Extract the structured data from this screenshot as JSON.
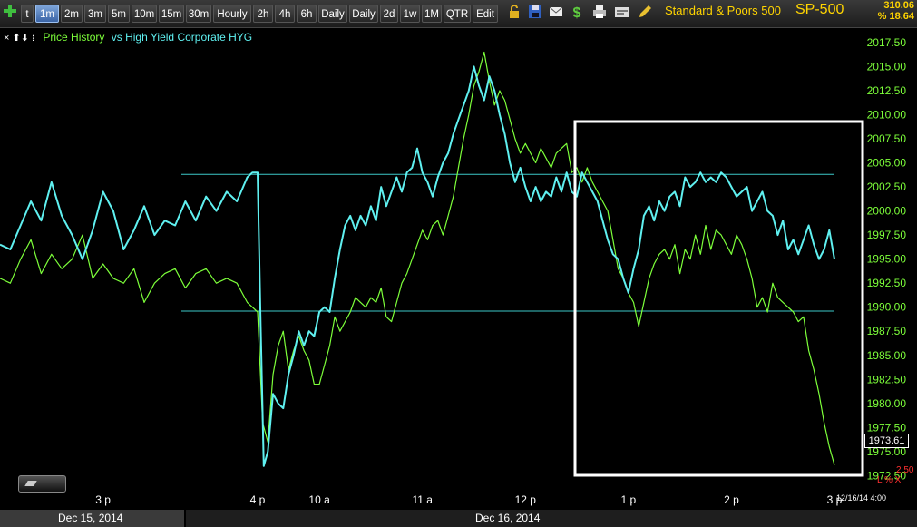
{
  "toolbar": {
    "timeframes": [
      "t",
      "1m",
      "2m",
      "3m",
      "5m",
      "10m",
      "15m",
      "30m",
      "Hourly",
      "2h",
      "4h",
      "6h",
      "Daily",
      "Daily",
      "2d",
      "1w",
      "1M",
      "QTR",
      "Edit"
    ],
    "active_timeframe": "1m",
    "icons": [
      "lock-icon",
      "save-icon",
      "email-icon",
      "dollar-icon",
      "print-icon",
      "settings-icon",
      "pencil-icon"
    ]
  },
  "symbol": {
    "name": "Standard & Poors 500",
    "ticker": "SP-500",
    "quote_top": "310.06",
    "quote_bottom": "% 18.64"
  },
  "legend": {
    "controls": "× ⬆⬇ ⁞",
    "price_label": "Price History",
    "vs_label": "vs High Yield Corporate HYG"
  },
  "price_tag": "1973.61",
  "side_labels": {
    "value": "2.50",
    "flags": "L % X"
  },
  "footer": {
    "timestamp": "12/16/14 4:00",
    "date1": "Dec 15, 2014",
    "date2": "Dec 16, 2014"
  },
  "colors": {
    "price": "#7dff3a",
    "hyg": "#5ff0f0",
    "axis_text": "#7dff3a",
    "background": "#000000",
    "highlight_box": "#ffffff",
    "hline": "#3cc8c8"
  },
  "chart_data": {
    "type": "line",
    "title": "",
    "y_ticks": [
      2017.5,
      2015.0,
      2012.5,
      2010.0,
      2007.5,
      2005.0,
      2002.5,
      2000.0,
      1997.5,
      1995.0,
      1992.5,
      1990.0,
      1987.5,
      1985.0,
      1982.5,
      1980.0,
      1977.5,
      1975.0,
      1972.5
    ],
    "ylim": [
      1971.5,
      2019.0
    ],
    "x_labels": [
      "3 p",
      "4 p",
      "10 a",
      "11 a",
      "12 p",
      "1 p",
      "2 p",
      "3 p"
    ],
    "x_label_pos": [
      1.5,
      3.0,
      3.6,
      4.6,
      5.6,
      6.6,
      7.6,
      8.6
    ],
    "xlim": [
      0.5,
      8.6
    ],
    "horizontal_lines": [
      2003.8,
      1989.6
    ],
    "series": [
      {
        "name": "Price History",
        "color": "#7dff3a",
        "points": [
          [
            0.5,
            1993.0
          ],
          [
            0.6,
            1992.5
          ],
          [
            0.7,
            1995.0
          ],
          [
            0.8,
            1997.0
          ],
          [
            0.9,
            1993.5
          ],
          [
            1.0,
            1995.5
          ],
          [
            1.1,
            1994.0
          ],
          [
            1.2,
            1995.0
          ],
          [
            1.3,
            1997.5
          ],
          [
            1.4,
            1993.0
          ],
          [
            1.5,
            1994.5
          ],
          [
            1.6,
            1993.0
          ],
          [
            1.7,
            1992.5
          ],
          [
            1.8,
            1994.0
          ],
          [
            1.9,
            1990.5
          ],
          [
            2.0,
            1992.5
          ],
          [
            2.1,
            1993.5
          ],
          [
            2.2,
            1994.0
          ],
          [
            2.3,
            1992.0
          ],
          [
            2.4,
            1993.5
          ],
          [
            2.5,
            1994.0
          ],
          [
            2.6,
            1992.5
          ],
          [
            2.7,
            1993.0
          ],
          [
            2.8,
            1992.5
          ],
          [
            2.9,
            1990.5
          ],
          [
            2.95,
            1990.0
          ],
          [
            3.0,
            1989.5
          ],
          [
            3.05,
            1978.0
          ],
          [
            3.1,
            1976.0
          ],
          [
            3.15,
            1983.0
          ],
          [
            3.2,
            1986.0
          ],
          [
            3.25,
            1987.5
          ],
          [
            3.3,
            1983.5
          ],
          [
            3.35,
            1985.5
          ],
          [
            3.4,
            1987.0
          ],
          [
            3.45,
            1985.5
          ],
          [
            3.5,
            1984.5
          ],
          [
            3.55,
            1982.0
          ],
          [
            3.6,
            1982.0
          ],
          [
            3.65,
            1984.0
          ],
          [
            3.7,
            1986.0
          ],
          [
            3.75,
            1989.0
          ],
          [
            3.8,
            1987.5
          ],
          [
            3.85,
            1988.5
          ],
          [
            3.9,
            1989.5
          ],
          [
            3.95,
            1991.0
          ],
          [
            4.0,
            1990.5
          ],
          [
            4.05,
            1990.0
          ],
          [
            4.1,
            1991.0
          ],
          [
            4.15,
            1990.5
          ],
          [
            4.2,
            1992.0
          ],
          [
            4.25,
            1989.0
          ],
          [
            4.3,
            1988.5
          ],
          [
            4.35,
            1990.5
          ],
          [
            4.4,
            1992.5
          ],
          [
            4.45,
            1993.5
          ],
          [
            4.5,
            1995.0
          ],
          [
            4.55,
            1996.5
          ],
          [
            4.6,
            1998.0
          ],
          [
            4.65,
            1997.0
          ],
          [
            4.7,
            1998.5
          ],
          [
            4.75,
            1999.0
          ],
          [
            4.8,
            1997.5
          ],
          [
            4.85,
            1999.5
          ],
          [
            4.9,
            2001.5
          ],
          [
            4.95,
            2004.5
          ],
          [
            5.0,
            2007.5
          ],
          [
            5.05,
            2010.0
          ],
          [
            5.1,
            2013.0
          ],
          [
            5.15,
            2014.5
          ],
          [
            5.2,
            2016.5
          ],
          [
            5.25,
            2013.5
          ],
          [
            5.3,
            2011.0
          ],
          [
            5.35,
            2012.5
          ],
          [
            5.4,
            2011.5
          ],
          [
            5.45,
            2009.5
          ],
          [
            5.5,
            2007.5
          ],
          [
            5.55,
            2006.0
          ],
          [
            5.6,
            2007.0
          ],
          [
            5.65,
            2006.0
          ],
          [
            5.7,
            2005.0
          ],
          [
            5.75,
            2006.5
          ],
          [
            5.8,
            2005.5
          ],
          [
            5.85,
            2004.5
          ],
          [
            5.9,
            2006.0
          ],
          [
            5.95,
            2006.5
          ],
          [
            6.0,
            2007.0
          ],
          [
            6.05,
            2004.0
          ],
          [
            6.1,
            2004.5
          ],
          [
            6.15,
            2003.0
          ],
          [
            6.2,
            2004.5
          ],
          [
            6.25,
            2003.0
          ],
          [
            6.3,
            2002.0
          ],
          [
            6.35,
            2001.0
          ],
          [
            6.4,
            2000.0
          ],
          [
            6.45,
            1997.0
          ],
          [
            6.5,
            1994.0
          ],
          [
            6.55,
            1993.0
          ],
          [
            6.6,
            1991.5
          ],
          [
            6.65,
            1990.5
          ],
          [
            6.7,
            1988.0
          ],
          [
            6.75,
            1990.5
          ],
          [
            6.8,
            1993.0
          ],
          [
            6.85,
            1994.5
          ],
          [
            6.9,
            1995.5
          ],
          [
            6.95,
            1996.0
          ],
          [
            7.0,
            1995.0
          ],
          [
            7.05,
            1996.5
          ],
          [
            7.1,
            1993.5
          ],
          [
            7.15,
            1996.0
          ],
          [
            7.2,
            1995.0
          ],
          [
            7.25,
            1997.5
          ],
          [
            7.3,
            1995.5
          ],
          [
            7.35,
            1998.5
          ],
          [
            7.4,
            1996.0
          ],
          [
            7.45,
            1998.0
          ],
          [
            7.5,
            1997.5
          ],
          [
            7.55,
            1996.5
          ],
          [
            7.6,
            1995.5
          ],
          [
            7.65,
            1997.5
          ],
          [
            7.7,
            1996.5
          ],
          [
            7.75,
            1995.0
          ],
          [
            7.8,
            1993.0
          ],
          [
            7.85,
            1990.0
          ],
          [
            7.9,
            1991.0
          ],
          [
            7.95,
            1989.5
          ],
          [
            8.0,
            1992.5
          ],
          [
            8.05,
            1991.0
          ],
          [
            8.1,
            1990.5
          ],
          [
            8.15,
            1990.0
          ],
          [
            8.2,
            1989.5
          ],
          [
            8.25,
            1988.5
          ],
          [
            8.3,
            1989.0
          ],
          [
            8.35,
            1985.5
          ],
          [
            8.4,
            1983.5
          ],
          [
            8.45,
            1981.0
          ],
          [
            8.5,
            1978.0
          ],
          [
            8.55,
            1975.5
          ],
          [
            8.6,
            1973.6
          ]
        ]
      },
      {
        "name": "vs High Yield Corporate HYG",
        "color": "#5ff0f0",
        "points": [
          [
            0.5,
            1996.5
          ],
          [
            0.6,
            1996.0
          ],
          [
            0.7,
            1998.5
          ],
          [
            0.8,
            2001.0
          ],
          [
            0.9,
            1999.0
          ],
          [
            1.0,
            2003.0
          ],
          [
            1.1,
            1999.5
          ],
          [
            1.2,
            1997.5
          ],
          [
            1.3,
            1995.0
          ],
          [
            1.4,
            1998.0
          ],
          [
            1.5,
            2002.0
          ],
          [
            1.6,
            2000.0
          ],
          [
            1.7,
            1996.0
          ],
          [
            1.8,
            1998.0
          ],
          [
            1.9,
            2000.5
          ],
          [
            2.0,
            1997.5
          ],
          [
            2.1,
            1999.0
          ],
          [
            2.2,
            1998.5
          ],
          [
            2.3,
            2001.0
          ],
          [
            2.4,
            1999.0
          ],
          [
            2.5,
            2001.5
          ],
          [
            2.6,
            2000.0
          ],
          [
            2.7,
            2002.0
          ],
          [
            2.8,
            2001.0
          ],
          [
            2.9,
            2003.5
          ],
          [
            2.95,
            2004.0
          ],
          [
            3.0,
            2004.0
          ],
          [
            3.03,
            1988.0
          ],
          [
            3.06,
            1973.5
          ],
          [
            3.1,
            1975.0
          ],
          [
            3.15,
            1981.0
          ],
          [
            3.2,
            1980.0
          ],
          [
            3.25,
            1979.5
          ],
          [
            3.3,
            1983.0
          ],
          [
            3.35,
            1985.0
          ],
          [
            3.4,
            1987.5
          ],
          [
            3.45,
            1986.0
          ],
          [
            3.5,
            1987.5
          ],
          [
            3.55,
            1987.0
          ],
          [
            3.6,
            1989.5
          ],
          [
            3.65,
            1990.0
          ],
          [
            3.7,
            1989.5
          ],
          [
            3.75,
            1993.0
          ],
          [
            3.8,
            1996.0
          ],
          [
            3.85,
            1998.5
          ],
          [
            3.9,
            1999.5
          ],
          [
            3.95,
            1998.0
          ],
          [
            4.0,
            1999.5
          ],
          [
            4.05,
            1998.5
          ],
          [
            4.1,
            2000.5
          ],
          [
            4.15,
            1999.0
          ],
          [
            4.2,
            2002.5
          ],
          [
            4.25,
            2000.5
          ],
          [
            4.3,
            2002.0
          ],
          [
            4.35,
            2003.5
          ],
          [
            4.4,
            2002.0
          ],
          [
            4.45,
            2004.0
          ],
          [
            4.5,
            2004.5
          ],
          [
            4.55,
            2006.5
          ],
          [
            4.6,
            2004.0
          ],
          [
            4.65,
            2003.0
          ],
          [
            4.7,
            2001.5
          ],
          [
            4.75,
            2003.5
          ],
          [
            4.8,
            2005.0
          ],
          [
            4.85,
            2006.0
          ],
          [
            4.9,
            2008.0
          ],
          [
            4.95,
            2009.5
          ],
          [
            5.0,
            2011.0
          ],
          [
            5.05,
            2012.5
          ],
          [
            5.1,
            2015.0
          ],
          [
            5.15,
            2013.0
          ],
          [
            5.2,
            2011.5
          ],
          [
            5.25,
            2014.0
          ],
          [
            5.3,
            2012.5
          ],
          [
            5.35,
            2010.0
          ],
          [
            5.4,
            2008.0
          ],
          [
            5.45,
            2005.0
          ],
          [
            5.5,
            2003.0
          ],
          [
            5.55,
            2004.5
          ],
          [
            5.6,
            2002.5
          ],
          [
            5.65,
            2001.0
          ],
          [
            5.7,
            2002.5
          ],
          [
            5.75,
            2001.0
          ],
          [
            5.8,
            2002.0
          ],
          [
            5.85,
            2001.5
          ],
          [
            5.9,
            2003.5
          ],
          [
            5.95,
            2002.0
          ],
          [
            6.0,
            2004.0
          ],
          [
            6.05,
            2002.0
          ],
          [
            6.1,
            2001.5
          ],
          [
            6.15,
            2004.0
          ],
          [
            6.2,
            2003.0
          ],
          [
            6.25,
            2002.0
          ],
          [
            6.3,
            2001.0
          ],
          [
            6.35,
            1999.0
          ],
          [
            6.4,
            1997.0
          ],
          [
            6.45,
            1995.5
          ],
          [
            6.5,
            1995.0
          ],
          [
            6.55,
            1993.0
          ],
          [
            6.6,
            1991.5
          ],
          [
            6.65,
            1994.0
          ],
          [
            6.7,
            1996.0
          ],
          [
            6.75,
            1999.5
          ],
          [
            6.8,
            2000.5
          ],
          [
            6.85,
            1999.0
          ],
          [
            6.9,
            2001.0
          ],
          [
            6.95,
            2000.0
          ],
          [
            7.0,
            2001.5
          ],
          [
            7.05,
            2002.0
          ],
          [
            7.1,
            2000.5
          ],
          [
            7.15,
            2003.5
          ],
          [
            7.2,
            2002.5
          ],
          [
            7.25,
            2003.0
          ],
          [
            7.3,
            2004.0
          ],
          [
            7.35,
            2003.0
          ],
          [
            7.4,
            2003.5
          ],
          [
            7.45,
            2003.0
          ],
          [
            7.5,
            2004.0
          ],
          [
            7.55,
            2003.5
          ],
          [
            7.6,
            2002.5
          ],
          [
            7.65,
            2001.5
          ],
          [
            7.7,
            2002.0
          ],
          [
            7.75,
            2002.5
          ],
          [
            7.8,
            2000.0
          ],
          [
            7.85,
            2001.0
          ],
          [
            7.9,
            2002.0
          ],
          [
            7.95,
            2000.0
          ],
          [
            8.0,
            1999.5
          ],
          [
            8.05,
            1997.5
          ],
          [
            8.1,
            1999.0
          ],
          [
            8.15,
            1996.0
          ],
          [
            8.2,
            1997.0
          ],
          [
            8.25,
            1995.5
          ],
          [
            8.3,
            1997.0
          ],
          [
            8.35,
            1998.5
          ],
          [
            8.4,
            1996.5
          ],
          [
            8.45,
            1995.0
          ],
          [
            8.5,
            1996.0
          ],
          [
            8.55,
            1998.0
          ],
          [
            8.6,
            1995.0
          ]
        ]
      }
    ]
  }
}
